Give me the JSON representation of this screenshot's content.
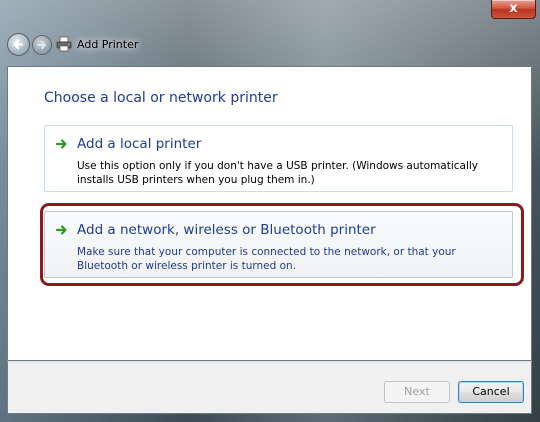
{
  "window": {
    "title": "Add Printer",
    "close_label": "x"
  },
  "main": {
    "heading": "Choose a local or network printer",
    "options": [
      {
        "title": "Add a local printer",
        "description": "Use this option only if you don't have a USB printer. (Windows automatically installs USB printers when you plug them in.)"
      },
      {
        "title": "Add a network, wireless or Bluetooth printer",
        "description": "Make sure that your computer is connected to the network, or that your Bluetooth or wireless printer is turned on."
      }
    ]
  },
  "footer": {
    "next_label": "Next",
    "cancel_label": "Cancel"
  },
  "colors": {
    "link_blue": "#1e3c96",
    "highlight_red": "#8b1a1f",
    "arrow_green": "#2e9a2e"
  }
}
